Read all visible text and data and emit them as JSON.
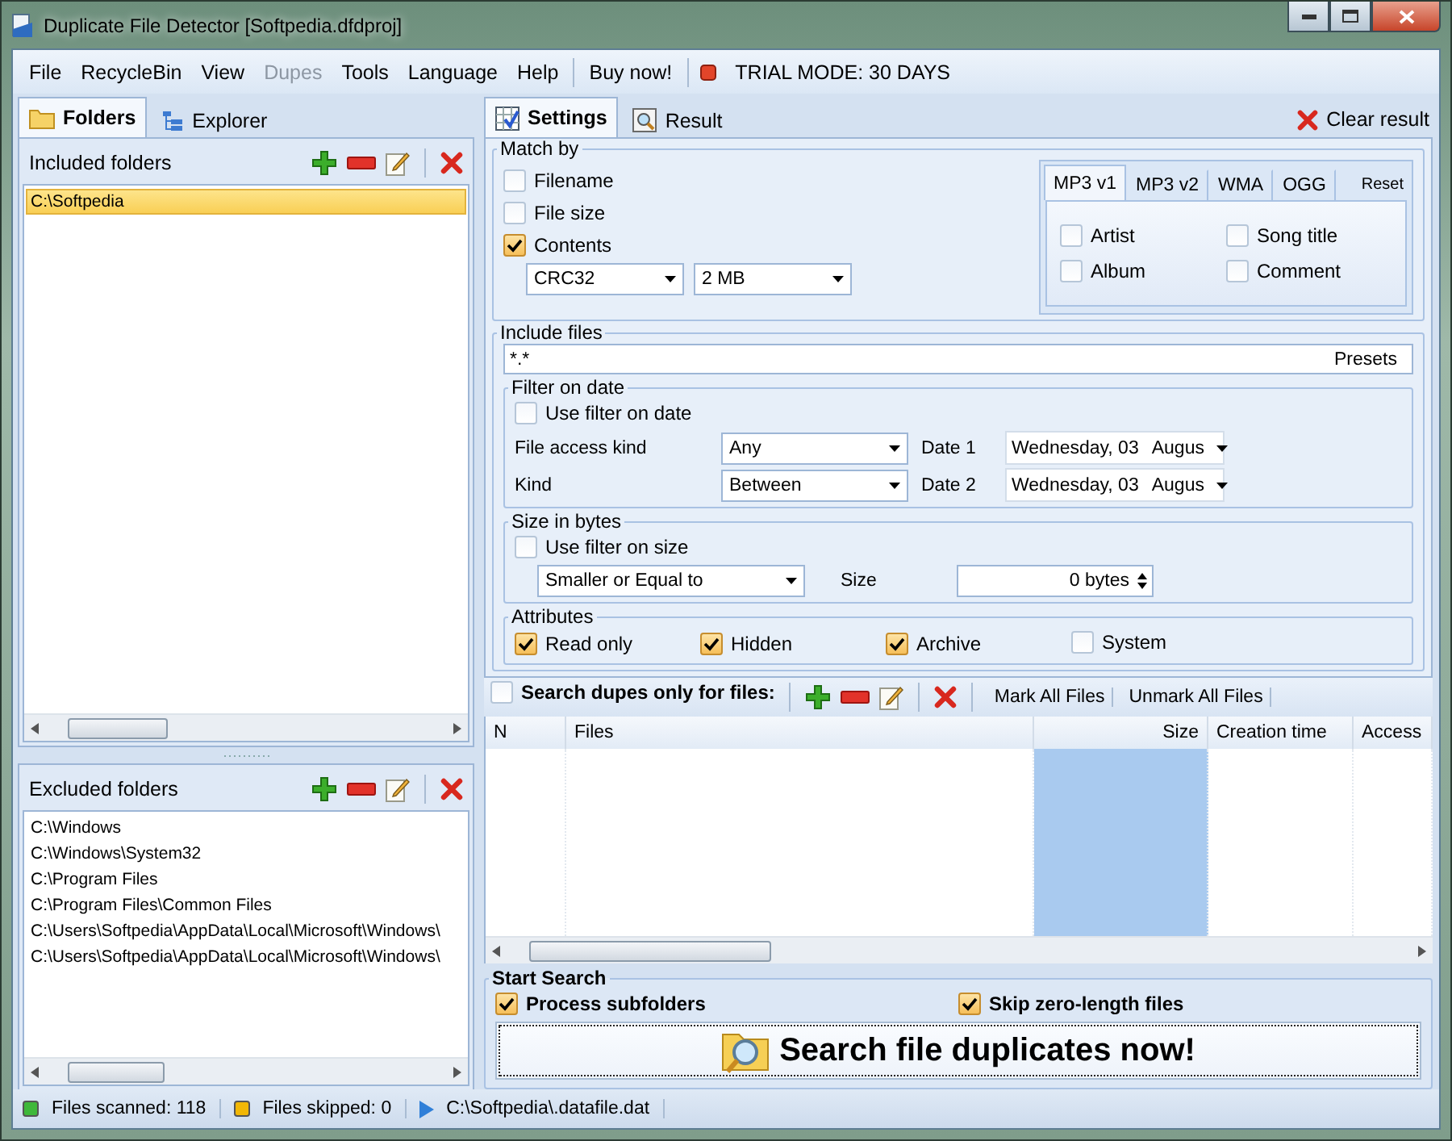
{
  "window": {
    "title": "Duplicate File Detector [Softpedia.dfdproj]"
  },
  "menu": [
    {
      "label": "File",
      "disabled": false
    },
    {
      "label": "RecycleBin",
      "disabled": false
    },
    {
      "label": "View",
      "disabled": false
    },
    {
      "label": "Dupes",
      "disabled": true
    },
    {
      "label": "Tools",
      "disabled": false
    },
    {
      "label": "Language",
      "disabled": false
    },
    {
      "label": "Help",
      "disabled": false
    }
  ],
  "buy_now": "Buy now!",
  "trial": "TRIAL MODE: 30 DAYS",
  "left_tabs": [
    {
      "label": "Folders",
      "selected": true
    },
    {
      "label": "Explorer",
      "selected": false
    }
  ],
  "included": {
    "title": "Included folders",
    "items": [
      {
        "label": "C:\\Softpedia",
        "selected": true
      }
    ]
  },
  "excluded": {
    "title": "Excluded folders",
    "items": [
      {
        "label": "C:\\Windows",
        "selected": false
      },
      {
        "label": "C:\\Windows\\System32",
        "selected": false
      },
      {
        "label": "C:\\Program Files",
        "selected": false
      },
      {
        "label": "C:\\Program Files\\Common Files",
        "selected": false
      },
      {
        "label": "C:\\Users\\Softpedia\\AppData\\Local\\Microsoft\\Windows\\",
        "selected": false
      },
      {
        "label": "C:\\Users\\Softpedia\\AppData\\Local\\Microsoft\\Windows\\",
        "selected": false
      }
    ]
  },
  "right_tabs": [
    {
      "label": "Settings",
      "selected": true
    },
    {
      "label": "Result",
      "selected": false
    }
  ],
  "clear_result": "Clear result",
  "match_by": {
    "title": "Match by",
    "options": [
      {
        "label": "Filename",
        "checked": false
      },
      {
        "label": "File size",
        "checked": false
      },
      {
        "label": "Contents",
        "checked": true
      }
    ],
    "algorithm": "CRC32",
    "block_size": "2 MB"
  },
  "tags": {
    "tabs": [
      {
        "label": "MP3 v1",
        "selected": true
      },
      {
        "label": "MP3 v2",
        "selected": false
      },
      {
        "label": "WMA",
        "selected": false
      },
      {
        "label": "OGG",
        "selected": false
      }
    ],
    "reset": "Reset",
    "fields": [
      {
        "label": "Artist",
        "checked": false
      },
      {
        "label": "Song title",
        "checked": false
      },
      {
        "label": "Album",
        "checked": false
      },
      {
        "label": "Comment",
        "checked": false
      }
    ]
  },
  "include_files": {
    "title": "Include files",
    "value": "*.*",
    "presets": "Presets"
  },
  "date_filter": {
    "title": "Filter on date",
    "use": {
      "label": "Use filter on date",
      "checked": false
    },
    "rows": [
      {
        "label": "File access kind",
        "value": "Any",
        "date_label": "Date 1",
        "day": "Wednesday, 03",
        "month": "Augus"
      },
      {
        "label": "Kind",
        "value": "Between",
        "date_label": "Date 2",
        "day": "Wednesday, 03",
        "month": "Augus"
      }
    ]
  },
  "size_filter": {
    "title": "Size in bytes",
    "use": {
      "label": "Use filter on size",
      "checked": false
    },
    "comparison": "Smaller or Equal to",
    "size_label": "Size",
    "size": "0 bytes"
  },
  "attributes": {
    "title": "Attributes",
    "items": [
      {
        "label": "Read only",
        "checked": true
      },
      {
        "label": "Hidden",
        "checked": true
      },
      {
        "label": "Archive",
        "checked": true
      },
      {
        "label": "System",
        "checked": false
      }
    ]
  },
  "file_filter": {
    "search_only": {
      "label": "Search dupes only for files:",
      "checked": false
    },
    "mark_all": "Mark All Files",
    "unmark_all": "Unmark All Files",
    "columns": [
      {
        "label": "N",
        "selected": false
      },
      {
        "label": "Files",
        "selected": false
      },
      {
        "label": "Size",
        "selected": true
      },
      {
        "label": "Creation time",
        "selected": false
      },
      {
        "label": "Access",
        "selected": false
      }
    ]
  },
  "start": {
    "title": "Start Search",
    "options": [
      {
        "label": "Process subfolders",
        "checked": true
      },
      {
        "label": "Skip zero-length files",
        "checked": true
      }
    ],
    "button": "Search file duplicates now!"
  },
  "status_bar": [
    {
      "kind": "dot",
      "text": "Files scanned: 118",
      "color": "#3fb83a"
    },
    {
      "kind": "dot",
      "text": "Files skipped: 0",
      "color": "#f2b705"
    },
    {
      "kind": "arrow",
      "text": "C:\\Softpedia\\.datafile.dat",
      "color": "#2f7fd8"
    }
  ]
}
